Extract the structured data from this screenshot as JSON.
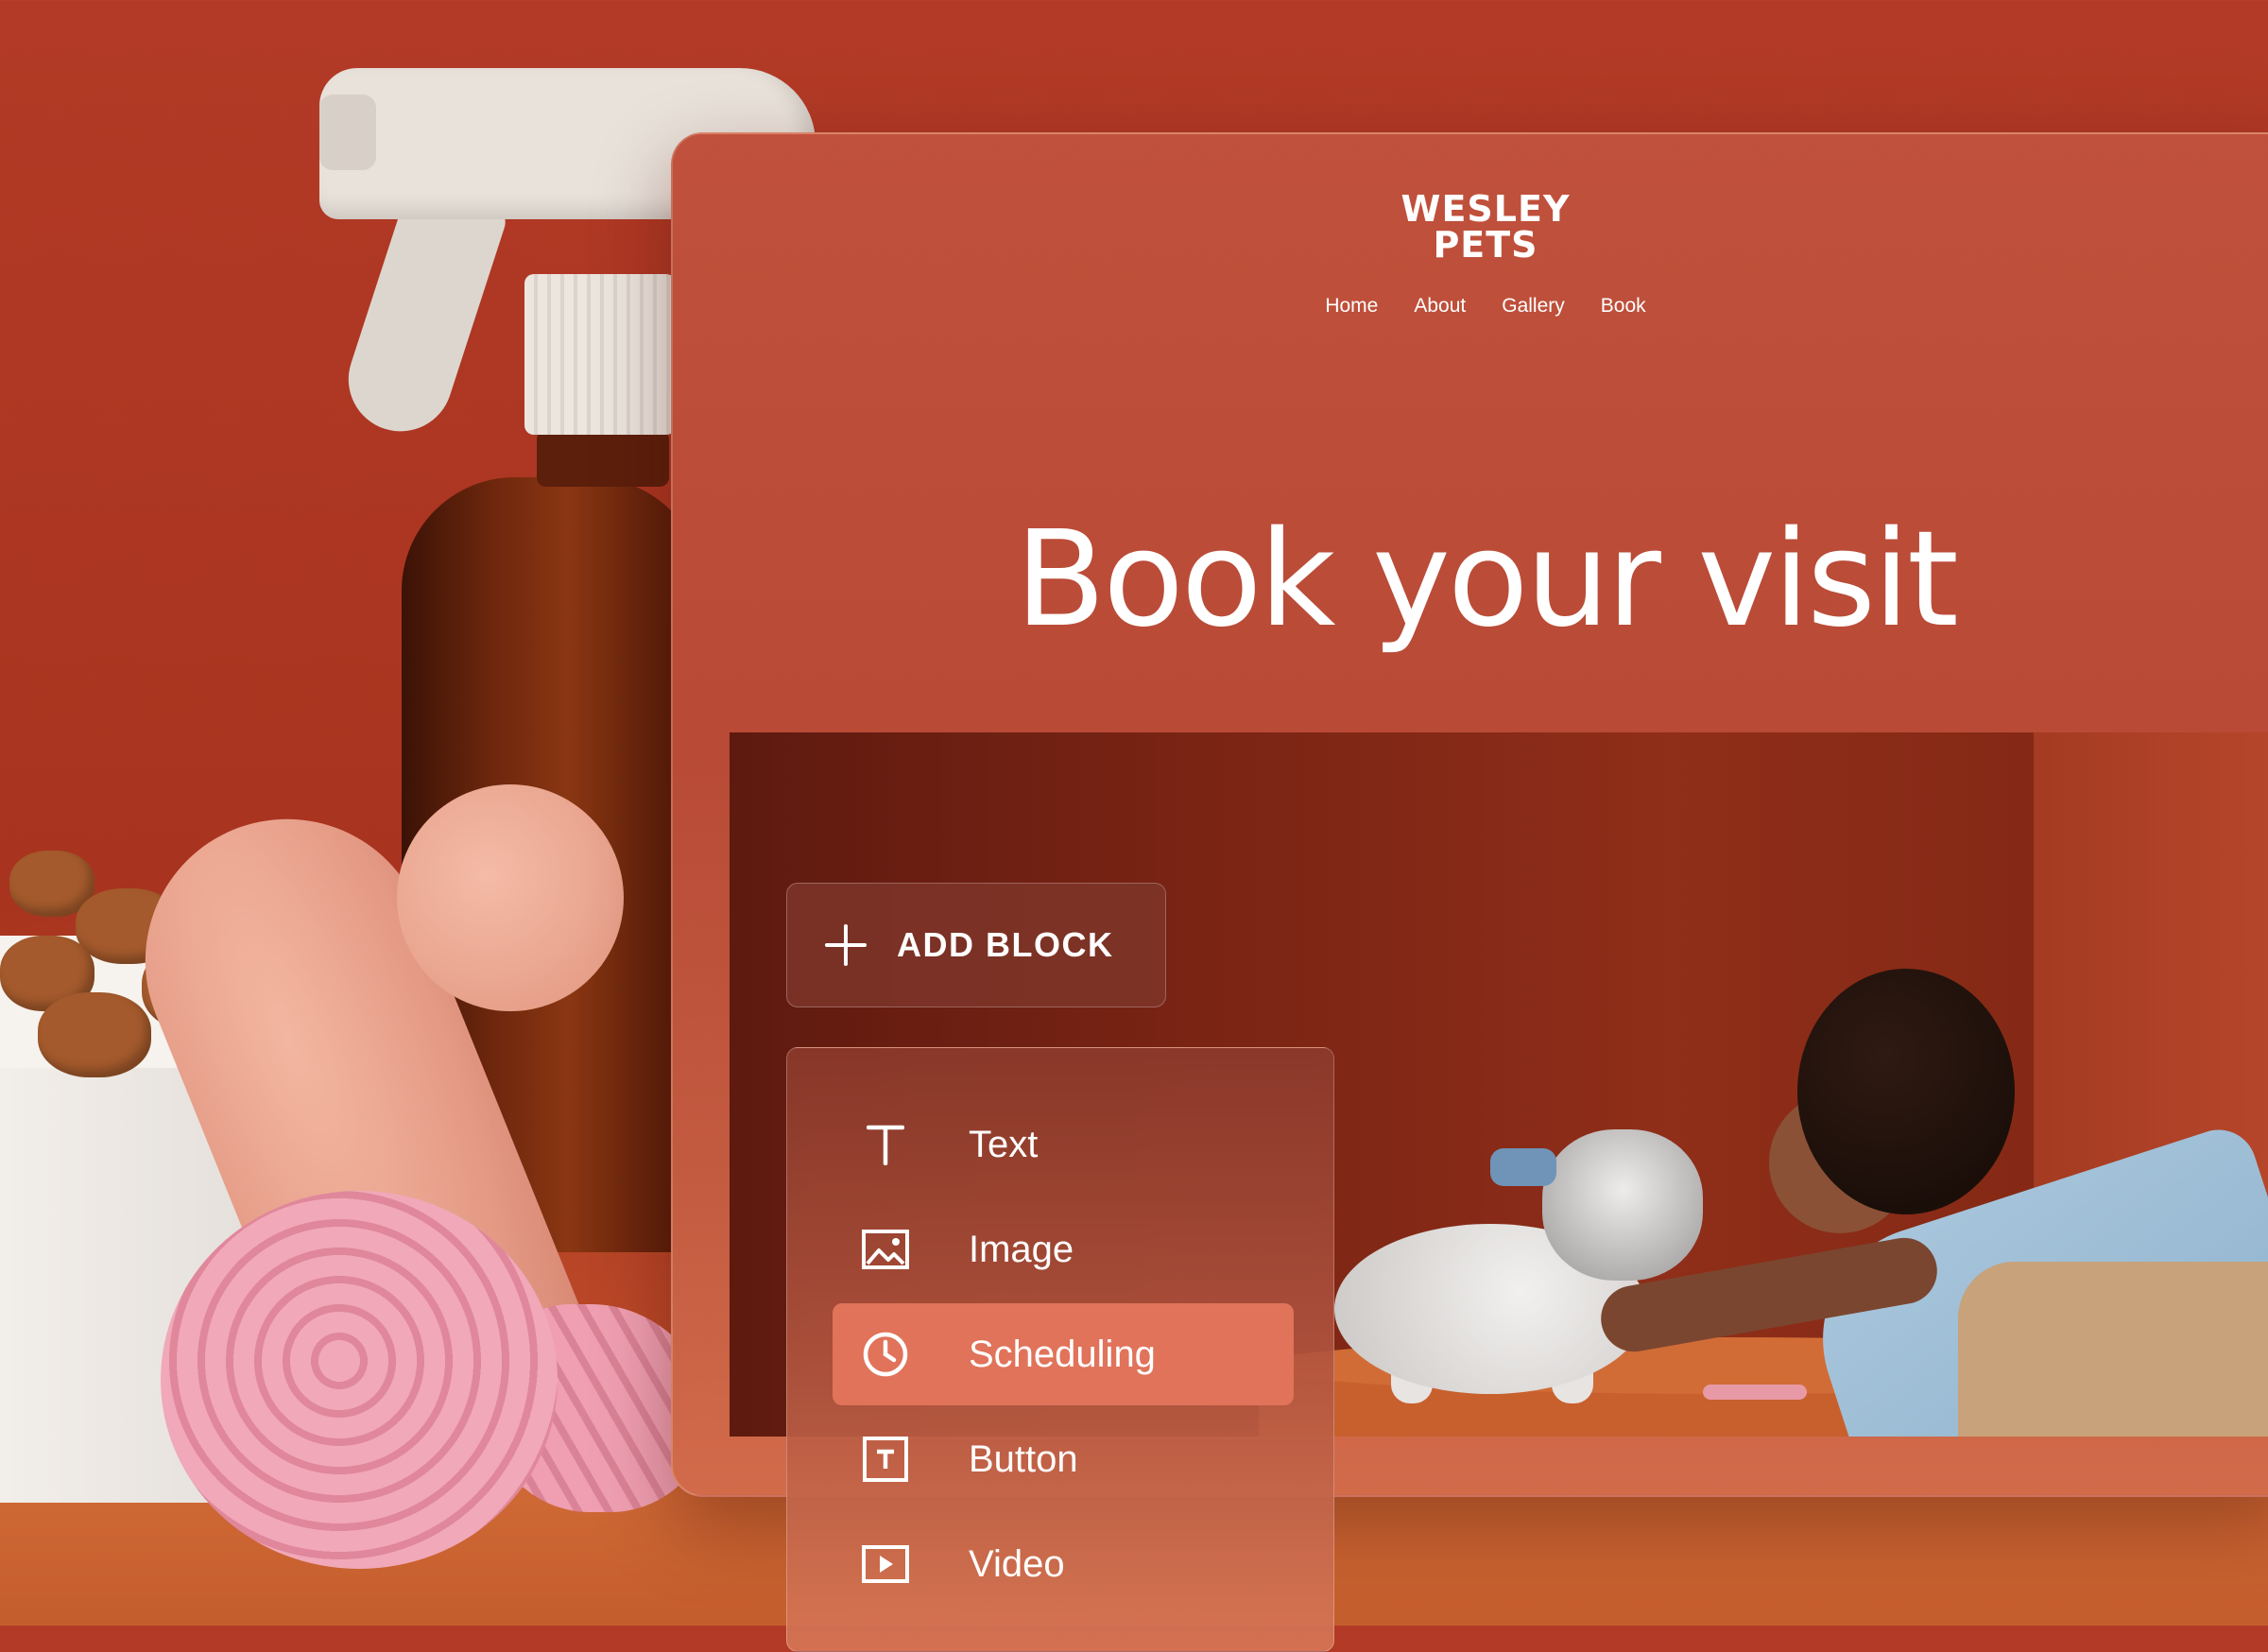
{
  "brand": {
    "line1": "WESLEY",
    "line2": "PETS"
  },
  "nav": {
    "items": [
      "Home",
      "About",
      "Gallery",
      "Book"
    ]
  },
  "hero": {
    "title": "Book your visit"
  },
  "add_block": {
    "label": "ADD BLOCK",
    "icon": "plus-icon"
  },
  "block_menu": {
    "items": [
      {
        "label": "Text",
        "icon": "text-icon",
        "selected": false
      },
      {
        "label": "Image",
        "icon": "image-icon",
        "selected": false
      },
      {
        "label": "Scheduling",
        "icon": "clock-icon",
        "selected": true
      },
      {
        "label": "Button",
        "icon": "button-icon",
        "selected": false
      },
      {
        "label": "Video",
        "icon": "video-icon",
        "selected": false
      }
    ]
  },
  "colors": {
    "background": "#a8341f",
    "window": "#b84a36",
    "selected_item": "#e0735a",
    "text": "#ffffff"
  }
}
